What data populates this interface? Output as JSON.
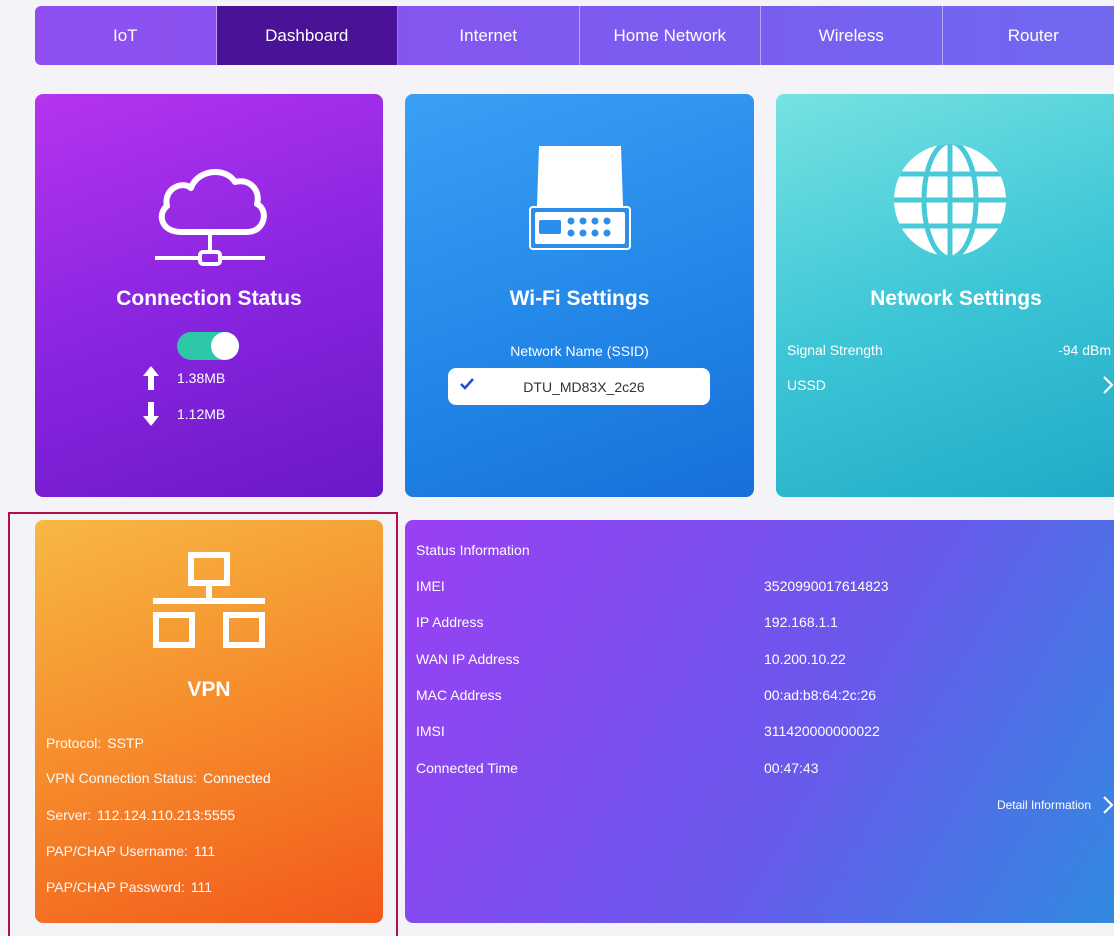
{
  "nav": {
    "tabs": [
      {
        "label": "IoT"
      },
      {
        "label": "Dashboard"
      },
      {
        "label": "Internet"
      },
      {
        "label": "Home Network"
      },
      {
        "label": "Wireless"
      },
      {
        "label": "Router"
      }
    ],
    "active": "Dashboard"
  },
  "connection": {
    "title": "Connection Status",
    "toggle_on": true,
    "upload": "1.38MB",
    "download": "1.12MB"
  },
  "wifi": {
    "title": "Wi-Fi Settings",
    "ssid_label": "Network Name (SSID)",
    "ssid": "DTU_MD83X_2c26"
  },
  "network": {
    "title": "Network Settings",
    "signal_label": "Signal Strength",
    "signal_value": "-94 dBm",
    "ussd_label": "USSD"
  },
  "vpn": {
    "title": "VPN",
    "protocol_label": "Protocol:",
    "protocol": "SSTP",
    "conn_status_label": "VPN Connection Status:",
    "conn_status": "Connected",
    "server_label": "Server:",
    "server": "112.124.110.213:5555",
    "username_label": "PAP/CHAP Username:",
    "username": "111",
    "password_label": "PAP/CHAP Password:",
    "password": "111"
  },
  "status": {
    "title": "Status Information",
    "rows": [
      {
        "label": "IMEI",
        "value": "3520990017614823"
      },
      {
        "label": "IP Address",
        "value": "192.168.1.1"
      },
      {
        "label": "WAN IP Address",
        "value": "10.200.10.22"
      },
      {
        "label": "MAC Address",
        "value": "00:ad:b8:64:2c:26"
      },
      {
        "label": "IMSI",
        "value": "311420000000022"
      },
      {
        "label": "Connected Time",
        "value": "00:47:43"
      }
    ],
    "detail_label": "Detail Information"
  },
  "colors": {
    "nav_active": "#4a1296",
    "toggle_on": "#2ec7a8",
    "highlight_border": "#b0114e"
  }
}
